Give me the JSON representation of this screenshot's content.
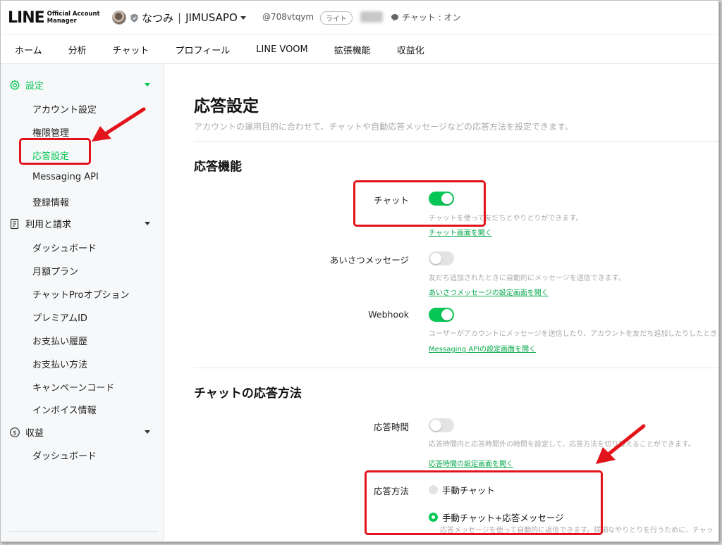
{
  "header": {
    "logo_main": "LINE",
    "logo_sub_1": "Official Account",
    "logo_sub_2": "Manager",
    "account_name": "なつみ",
    "account_sep": "|",
    "account_org": "JIMUSAPO",
    "account_id": "@708vtqym",
    "plan_badge": "ライト",
    "chat_status": "チャット : オン"
  },
  "nav": {
    "tabs": [
      {
        "label": "ホーム"
      },
      {
        "label": "分析"
      },
      {
        "label": "チャット"
      },
      {
        "label": "プロフィール"
      },
      {
        "label": "LINE VOOM"
      },
      {
        "label": "拡張機能"
      },
      {
        "label": "収益化"
      }
    ]
  },
  "sidebar": {
    "sections": [
      {
        "label": "設定",
        "items": [
          "アカウント設定",
          "権限管理",
          "応答設定",
          "Messaging API",
          "登録情報"
        ]
      },
      {
        "label": "利用と請求",
        "items": [
          "ダッシュボード",
          "月額プラン",
          "チャットProオプション",
          "プレミアムID",
          "お支払い履歴",
          "お支払い方法",
          "キャンペーンコード",
          "インボイス情報"
        ]
      },
      {
        "label": "収益",
        "items": [
          "ダッシュボード"
        ]
      }
    ]
  },
  "main": {
    "title": "応答設定",
    "description": "アカウントの運用目的に合わせて、チャットや自動応答メッセージなどの応答方法を設定できます。",
    "features_section": {
      "title": "応答機能",
      "rows": [
        {
          "label": "チャット",
          "enabled": true,
          "desc": "チャットを使って友だちとやりとりができます。",
          "link": "チャット画面を開く"
        },
        {
          "label": "あいさつメッセージ",
          "enabled": false,
          "desc": "友だち追加されたときに自動的にメッセージを送信できます。",
          "link": "あいさつメッセージの設定画面を開く"
        },
        {
          "label": "Webhook",
          "enabled": true,
          "desc": "ユーザーがアカウントにメッセージを送信したり、アカウントを友だち追加したりしたとき",
          "link": "Messaging APIの設定画面を開く"
        }
      ]
    },
    "chat_response_section": {
      "title": "チャットの応答方法",
      "hours": {
        "label": "応答時間",
        "enabled": false,
        "desc": "応答時間内と応答時間外の時間を設定して、応答方法を切り替えることができます。",
        "link": "応答時間の設定画面を開く"
      },
      "method": {
        "label": "応答方法",
        "options": [
          {
            "label": "手動チャット",
            "selected": false
          },
          {
            "label": "手動チャット+応答メッセージ",
            "selected": true
          }
        ],
        "selected_desc": "応答メッセージを使って自動的に返信できます。詳細なやりとりを行うために、チャッ"
      }
    }
  },
  "colors": {
    "accent": "#06c755",
    "annotation": "#e3131b"
  }
}
